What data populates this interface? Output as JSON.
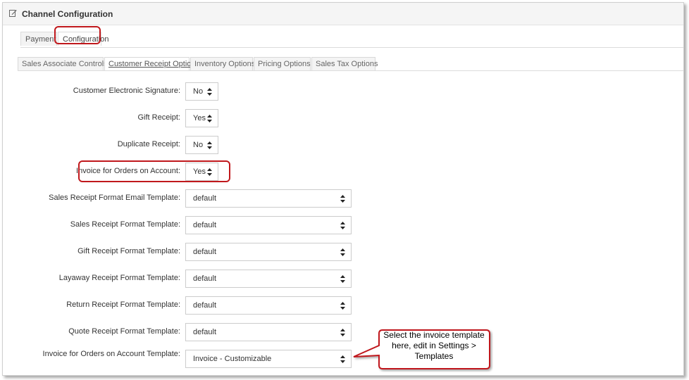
{
  "panel": {
    "title": "Channel Configuration",
    "icon": "edit-icon"
  },
  "top_tabs": [
    {
      "label": "Payment"
    },
    {
      "label": "Configuration"
    }
  ],
  "sub_tabs": [
    {
      "label": "Sales Associate Controls"
    },
    {
      "label": "Customer Receipt Options"
    },
    {
      "label": "Inventory Options"
    },
    {
      "label": "Pricing Options"
    },
    {
      "label": "Sales Tax Options"
    }
  ],
  "fields": [
    {
      "label": "Customer Electronic Signature:",
      "value": "No"
    },
    {
      "label": "Gift Receipt:",
      "value": "Yes"
    },
    {
      "label": "Duplicate Receipt:",
      "value": "No"
    },
    {
      "label": "Invoice for Orders on Account:",
      "value": "Yes"
    },
    {
      "label": "Sales Receipt Format Email Template:",
      "value": "default"
    },
    {
      "label": "Sales Receipt Format Template:",
      "value": "default"
    },
    {
      "label": "Gift Receipt Format Template:",
      "value": "default"
    },
    {
      "label": "Layaway Receipt Format Template:",
      "value": "default"
    },
    {
      "label": "Return Receipt Format Template:",
      "value": "default"
    },
    {
      "label": "Quote Receipt Format Template:",
      "value": "default"
    },
    {
      "label": "Invoice for Orders on Account Template:",
      "value": "Invoice - Customizable"
    }
  ],
  "callout": {
    "text": "Select the invoice template here, edit in Settings > Templates"
  },
  "colors": {
    "highlight": "#c0181c",
    "callout_border": "#c0181c",
    "callout_fill": "#ffffff"
  }
}
